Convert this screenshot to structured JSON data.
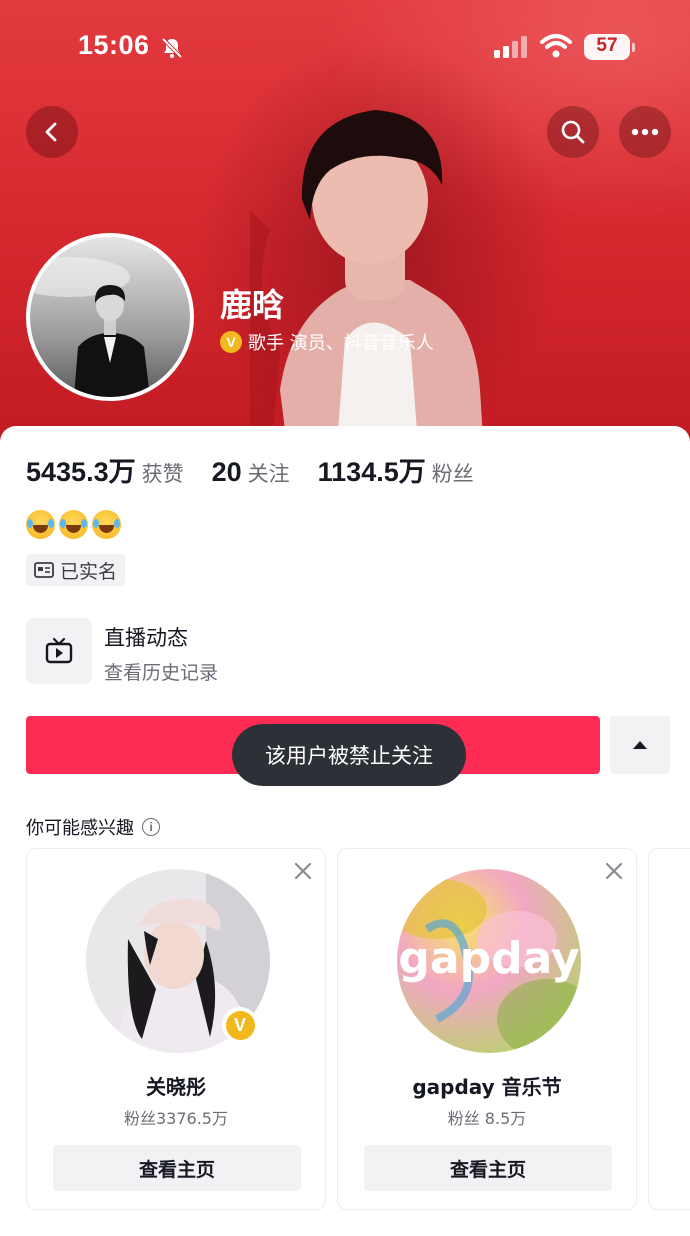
{
  "status_bar": {
    "time": "15:06",
    "battery": "57"
  },
  "profile": {
    "name": "鹿晗",
    "verification": "歌手 演员、抖音音乐人",
    "verified_badge": "V"
  },
  "stats": [
    {
      "value": "5435.3万",
      "label": "获赞"
    },
    {
      "value": "20",
      "label": "关注"
    },
    {
      "value": "1134.5万",
      "label": "粉丝"
    }
  ],
  "realname_tag": "已实名",
  "live": {
    "title": "直播动态",
    "subtitle": "查看历史记录"
  },
  "toast": "该用户被禁止关注",
  "recommend": {
    "title": "你可能感兴趣",
    "info_icon": "i",
    "cards": [
      {
        "name": "关晓彤",
        "fans": "粉丝3376.5万",
        "button": "查看主页",
        "badge": "V"
      },
      {
        "name": "gapday 音乐节",
        "fans": "粉丝 8.5万",
        "button": "查看主页",
        "logo_text": "gapday"
      }
    ]
  },
  "colors": {
    "cover": "#d3262d",
    "follow_button": "#fe2c55",
    "toast_bg": "#2e3038",
    "badge": "#f4b81f"
  },
  "icons": [
    "bell-off-icon",
    "signal-icon",
    "wifi-icon",
    "battery-icon",
    "back-icon",
    "search-icon",
    "more-icon",
    "id-card-icon",
    "tv-icon",
    "caret-up-icon",
    "info-icon",
    "close-icon"
  ]
}
